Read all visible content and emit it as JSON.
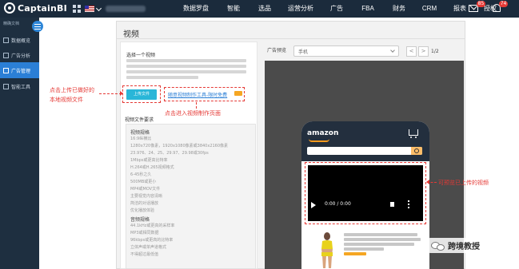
{
  "app": {
    "brand": "CaptainBI",
    "nav_items": [
      {
        "label": "数据罗盘",
        "width": 54
      },
      {
        "label": "智能",
        "width": 40
      },
      {
        "label": "选品",
        "width": 38
      },
      {
        "label": "运营分析",
        "width": 52
      },
      {
        "label": "广告",
        "width": 38
      },
      {
        "label": "FBA",
        "width": 40
      },
      {
        "label": "财务",
        "width": 38
      },
      {
        "label": "CRM",
        "width": 38
      },
      {
        "label": "报表",
        "width": 38
      },
      {
        "label": "授权",
        "width": 38
      }
    ],
    "mail_badge": "85",
    "bell_badge": "74"
  },
  "sidebar": {
    "title": "精确文档",
    "items": [
      {
        "label": "数据概览",
        "active": false
      },
      {
        "label": "广告分析",
        "active": false
      },
      {
        "label": "广告管理",
        "active": true
      },
      {
        "label": "智能工具",
        "active": false
      }
    ]
  },
  "page": {
    "title": "视频",
    "select_title": "选择一个视频",
    "upload_label": "上传文件",
    "tool_link": "随意视频制作工具-限时免费",
    "requirements_title": "视频文件要求",
    "video_spec_title": "视频规格",
    "video_specs": [
      "16:9纵横比",
      "1280x720像素，1920x1080像素或3840x2160像素",
      "23.976、24、25、29.97、29.98或30fps",
      "1Mbps或更高比特率",
      "H.264或H.265视频格式",
      "6-45秒之久",
      "500MB或更小",
      "MP4或MOV文件",
      "主要视觉内容清晰",
      "简洁的对话播放",
      "优化播放体验"
    ],
    "audio_spec_title": "音频规格",
    "audio_specs": [
      "44.1kHz或更高的采样率",
      "MP3或相同数据",
      "96kbps或更高的比特率",
      "立体声或单声道格式",
      "不得超过最低值"
    ]
  },
  "preview": {
    "label": "广告预览",
    "device": "手机",
    "pager": "1/2",
    "prev_icon": "<",
    "next_icon": ">",
    "amazon_logo": "amazon",
    "video_time": "0:00 / 0:00"
  },
  "annotations": {
    "upload_note_1": "点击上传已做好的",
    "upload_note_2": "本地视频文件",
    "tool_note": "点击进入视频制作页面",
    "video_note": "可预览已上传的视频"
  },
  "watermark": "跨境教授",
  "colors": {
    "accent": "#29b6d8",
    "annotation": "#e53935",
    "nav_bg": "#1b2b3c",
    "active_blue": "#2b7fd6"
  }
}
